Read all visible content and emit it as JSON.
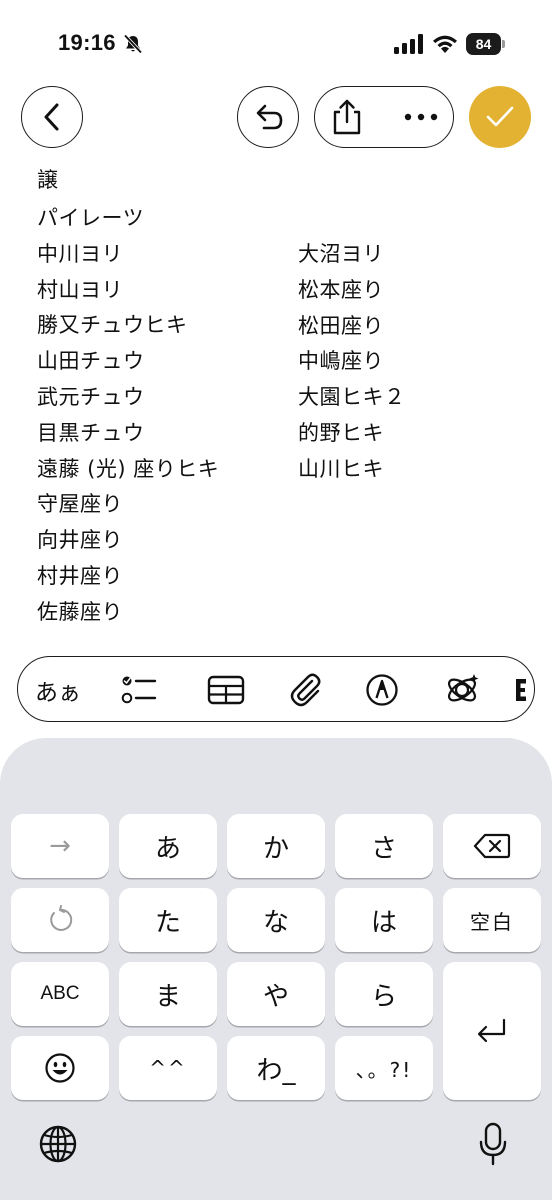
{
  "status_bar": {
    "time": "19:16",
    "battery": "84",
    "icons": [
      "bell-slash-icon",
      "signal-icon",
      "wifi-icon",
      "battery-icon"
    ]
  },
  "toolbar": {
    "icons": [
      "chevron-left-icon",
      "undo-icon",
      "share-icon",
      "ellipsis-icon",
      "checkmark-icon"
    ],
    "accent_color": "#e3b233"
  },
  "note": {
    "title": "譲",
    "left_column": [
      "パイレーツ",
      "中川ヨリ",
      "村山ヨリ",
      "勝又チュウヒキ",
      "山田チュウ",
      "武元チュウ",
      "目黒チュウ",
      "遠藤 (光) 座りヒキ",
      "守屋座り",
      "向井座り",
      "村井座り",
      "佐藤座り"
    ],
    "right_column": [
      "大沼ヨリ",
      "松本座り",
      "松田座り",
      "中嶋座り",
      "大園ヒキ２",
      "的野ヒキ",
      "山川ヒキ"
    ]
  },
  "format_bar": {
    "text_style": "あぁ",
    "icons": [
      "checklist-icon",
      "table-icon",
      "paperclip-icon",
      "markup-pen-icon",
      "apple-intelligence-icon",
      "more-icon"
    ]
  },
  "keyboard": {
    "row1": [
      "→",
      "あ",
      "か",
      "さ"
    ],
    "row2": [
      "た",
      "な",
      "は",
      "空白"
    ],
    "row3": [
      "ABC",
      "ま",
      "や",
      "ら"
    ],
    "row4": [
      "^^",
      "わ_",
      "、。?!"
    ],
    "icons": [
      "delete-icon",
      "undo-icon",
      "return-icon",
      "emoji-icon",
      "globe-icon",
      "microphone-icon"
    ]
  }
}
